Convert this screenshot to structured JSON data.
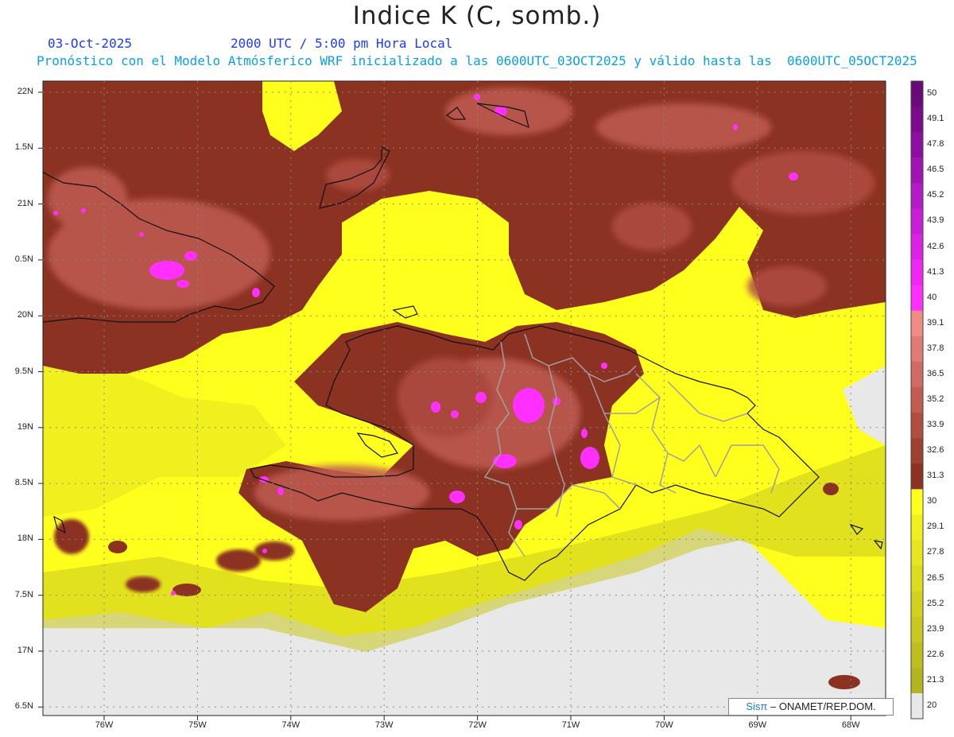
{
  "title": "Indice K (C, somb.)",
  "date": "03-Oct-2025",
  "time": "2000 UTC / 5:00 pm Hora Local",
  "subtitle": "Pronóstico con el Modelo Atmósferico WRF inicializado a las 0600UTC_03OCT2025 y válido hasta las  0600UTC_05OCT2025",
  "credit": {
    "prefix": "Sis",
    "pi": "π",
    "text": "– ONAMET/REP.DOM."
  },
  "lat_labels": [
    "22N",
    "1.5N",
    "21N",
    "0.5N",
    "20N",
    "9.5N",
    "19N",
    "8.5N",
    "18N",
    "7.5N",
    "17N",
    "6.5N"
  ],
  "lon_labels": [
    "76W",
    "75W",
    "74W",
    "73W",
    "72W",
    "71W",
    "70W",
    "69W",
    "68W"
  ],
  "colorbar": {
    "labels": [
      "50",
      "49.1",
      "47.8",
      "46.5",
      "45.2",
      "43.9",
      "42.6",
      "41.3",
      "40",
      "39.1",
      "37.8",
      "36.5",
      "35.2",
      "33.9",
      "32.6",
      "31.3",
      "30",
      "29.1",
      "27.8",
      "26.5",
      "25.2",
      "23.9",
      "22.6",
      "21.3",
      "20"
    ],
    "colors": [
      "#6a0a78",
      "#7a0c8c",
      "#8c10a0",
      "#a014b4",
      "#b41ac8",
      "#c81ed8",
      "#dc22e6",
      "#f026f5",
      "#ff30ff",
      "#f08a84",
      "#e07a74",
      "#d06a64",
      "#c05c52",
      "#b04e42",
      "#9e4032",
      "#8c3222",
      "#ffff1e",
      "#f0f01e",
      "#e6e61e",
      "#dcdc1e",
      "#d2d21e",
      "#c8c81e",
      "#bebe1e",
      "#b4b41e",
      "#e8e8e8"
    ]
  },
  "map_colors": {
    "land_low": "#ffff1e",
    "sea_none": "#e8e8e8",
    "high": "#8c3222",
    "mid": "#c05c52",
    "peak": "#ff30ff"
  }
}
